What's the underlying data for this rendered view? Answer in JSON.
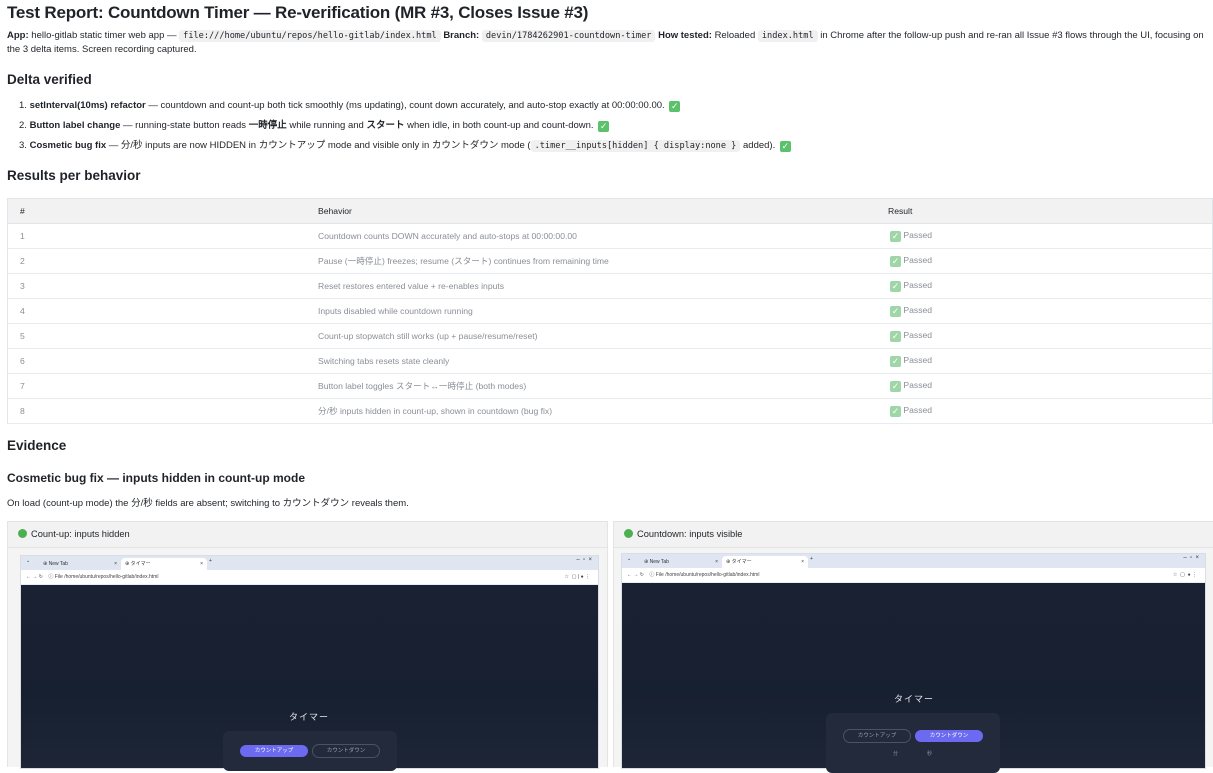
{
  "title": "Test Report: Countdown Timer — Re-verification (MR #3, Closes Issue #3)",
  "meta": {
    "app_label": "App:",
    "app_text": "hello-gitlab static timer web app —",
    "app_path": "file:///home/ubuntu/repos/hello-gitlab/index.html",
    "branch_label": "Branch:",
    "branch": "devin/1784262901-countdown-timer",
    "how_label": "How tested:",
    "how_text_a": "Reloaded",
    "how_file": "index.html",
    "how_text_b": "in Chrome after the follow-up push and re-ran all Issue #3 flows through the UI, focusing on the 3 delta items. Screen recording captured."
  },
  "delta": {
    "heading": "Delta verified",
    "items": [
      {
        "num": "1.",
        "bold": "setInterval(10ms) refactor",
        "text": " — countdown and count-up both tick smoothly (ms updating), count down accurately, and auto-stop exactly at 00:00:00.00."
      },
      {
        "num": "2.",
        "bold": "Button label change",
        "text_a": " — running-state button reads ",
        "jp_pause": "一時停止",
        "text_b": " while running and ",
        "jp_start": "スタート",
        "text_c": " when idle, in both count-up and count-down."
      },
      {
        "num": "3.",
        "bold": "Cosmetic bug fix",
        "text_a": " — 分/秒 inputs are now HIDDEN in カウントアップ mode and visible only in カウントダウン mode (",
        "code": ".timer__inputs[hidden] { display:none }",
        "text_b": " added)."
      }
    ]
  },
  "results": {
    "heading": "Results per behavior",
    "columns": [
      "#",
      "Behavior",
      "Result"
    ],
    "rows": [
      {
        "n": "1",
        "behavior": "Countdown counts DOWN accurately and auto-stops at 00:00:00.00",
        "result": "Passed"
      },
      {
        "n": "2",
        "behavior": "Pause (一時停止) freezes; resume (スタート) continues from remaining time",
        "result": "Passed"
      },
      {
        "n": "3",
        "behavior": "Reset restores entered value + re-enables inputs",
        "result": "Passed"
      },
      {
        "n": "4",
        "behavior": "Inputs disabled while countdown running",
        "result": "Passed"
      },
      {
        "n": "5",
        "behavior": "Count-up stopwatch still works (up + pause/resume/reset)",
        "result": "Passed"
      },
      {
        "n": "6",
        "behavior": "Switching tabs resets state cleanly",
        "result": "Passed"
      },
      {
        "n": "7",
        "behavior": "Button label toggles スタート↔一時停止 (both modes)",
        "result": "Passed"
      },
      {
        "n": "8",
        "behavior": "分/秒 inputs hidden in count-up, shown in countdown (bug fix)",
        "result": "Passed"
      }
    ]
  },
  "evidence": {
    "heading": "Evidence",
    "subheading": "Cosmetic bug fix — inputs hidden in count-up mode",
    "description": "On load (count-up mode) the 分/秒 fields are absent; switching to カウントダウン reveals them.",
    "panels": [
      {
        "label": "Count-up: inputs hidden",
        "tab1": "New Tab",
        "tab2": "タイマー",
        "url_prefix": "File",
        "url": "/home/ubuntu/repos/hello-gitlab/index.html",
        "app_title": "タイマー",
        "btn_up": "カウントアップ",
        "btn_down": "カウントダウン"
      },
      {
        "label": "Countdown: inputs visible",
        "tab1": "New Tab",
        "tab2": "タイマー",
        "url_prefix": "File",
        "url": "/home/ubuntu/repos/hello-gitlab/index.html",
        "app_title": "タイマー",
        "btn_up": "カウントアップ",
        "btn_down": "カウントダウン",
        "min_label": "分",
        "sec_label": "秒"
      }
    ]
  },
  "icons": {
    "check": "check-box-icon",
    "status": "green-dot-icon",
    "accent": "#6b6af0",
    "pass_color": "#5cc16b"
  }
}
